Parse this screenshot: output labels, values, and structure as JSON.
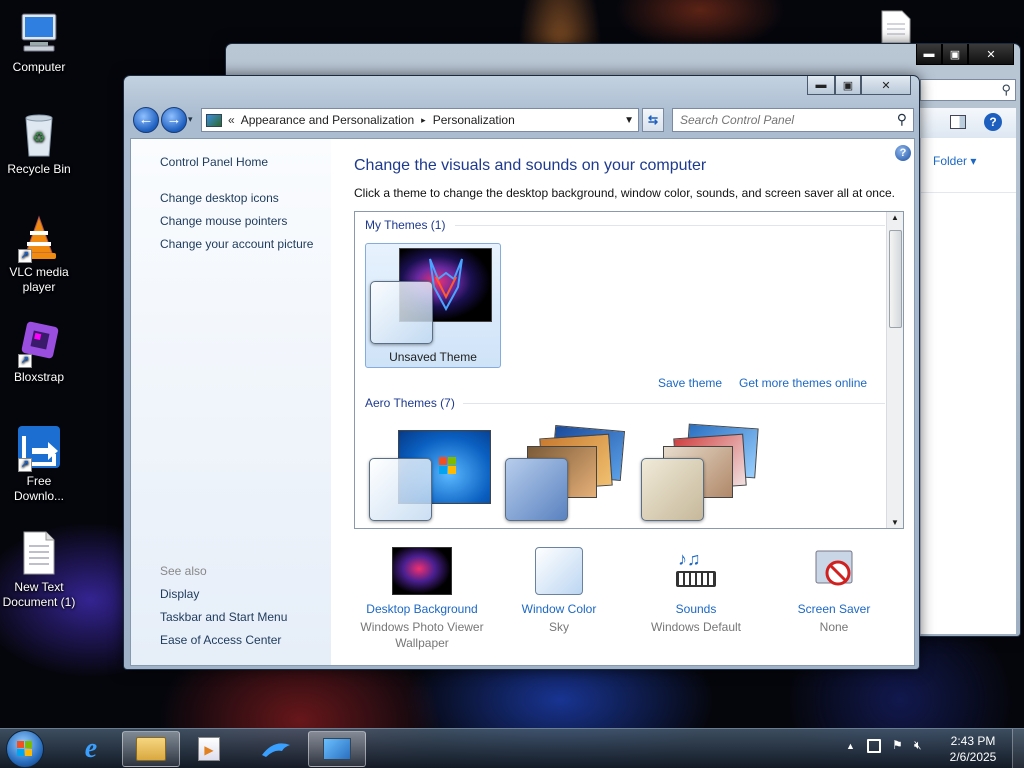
{
  "desktop": {
    "icons": [
      {
        "label": "Computer"
      },
      {
        "label": "Recycle Bin"
      },
      {
        "label": "VLC media player"
      },
      {
        "label": "Bloxstrap"
      },
      {
        "label": "Free Downlo..."
      },
      {
        "label": "New Text Document (1)"
      }
    ]
  },
  "back_window": {
    "toolbar_item": "Folder ▾"
  },
  "window": {
    "address": {
      "crumb_prefix": "«",
      "crumb1": "Appearance and Personalization",
      "separator": "▸",
      "crumb2": "Personalization"
    },
    "search": {
      "placeholder": "Search Control Panel"
    },
    "left": {
      "home": "Control Panel Home",
      "links": [
        "Change desktop icons",
        "Change mouse pointers",
        "Change your account picture"
      ],
      "see_also": "See also",
      "see_also_links": [
        "Display",
        "Taskbar and Start Menu",
        "Ease of Access Center"
      ]
    },
    "main": {
      "title": "Change the visuals and sounds on your computer",
      "subtitle": "Click a theme to change the desktop background, window color, sounds, and screen saver all at once.",
      "my_themes": "My Themes (1)",
      "unsaved": "Unsaved Theme",
      "save_theme": "Save theme",
      "get_more": "Get more themes online",
      "aero_themes": "Aero Themes (7)",
      "bottom": [
        {
          "link": "Desktop Background",
          "sub": "Windows Photo Viewer Wallpaper"
        },
        {
          "link": "Window Color",
          "sub": "Sky"
        },
        {
          "link": "Sounds",
          "sub": "Windows Default"
        },
        {
          "link": "Screen Saver",
          "sub": "None"
        }
      ]
    }
  },
  "taskbar": {
    "time": "2:43 PM",
    "date": "2/6/2025"
  },
  "colors": {
    "link": "#1c68c4",
    "title": "#1e3a8e"
  }
}
